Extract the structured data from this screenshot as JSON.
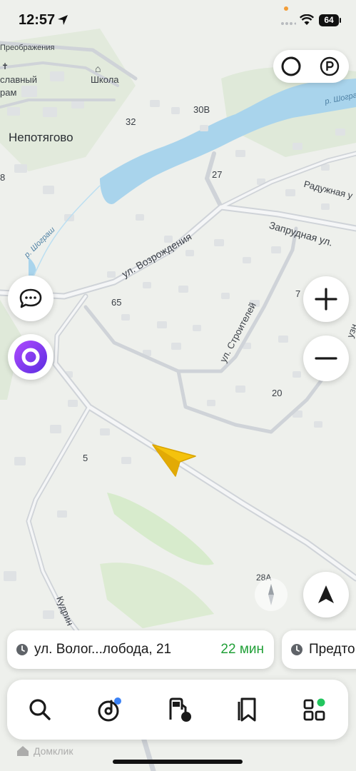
{
  "status_bar": {
    "time": "12:57",
    "battery": "64"
  },
  "map_labels": {
    "preobrazhenia": "Преображения",
    "slavny": "славный",
    "ram": "рам",
    "school": "Школа",
    "nepotyagovo": "Непотягово",
    "n32": "32",
    "n30v": "30В",
    "river_shogrash": "р. Шограш",
    "river_shogrash_2": "р. Шогра",
    "n27": "27",
    "raduzhnaya": "Радужная у",
    "vozrozhdeniya": "ул. Возрождения",
    "zaprudnaya": "Запрудная ул.",
    "n65": "65",
    "n7": "7",
    "stroiteley": "ул. Строителей",
    "n20": "20",
    "n5": "5",
    "n28a": "28А",
    "kudrin": "Кудрин",
    "edge_8": "8",
    "edge_uz": "узн"
  },
  "route": {
    "address": "ул. Волог...лобода, 21",
    "eta": "22 мин",
    "address_2": "Предто"
  },
  "bottom_nav": {
    "items": [
      "search",
      "music",
      "fuel",
      "bookmarks",
      "services"
    ]
  },
  "watermark": "Домклик",
  "colors": {
    "eta_green": "#21a038",
    "alice_purple": "#7a3cff",
    "water": "#a9d4ec",
    "arrow": "#f4c20d"
  }
}
